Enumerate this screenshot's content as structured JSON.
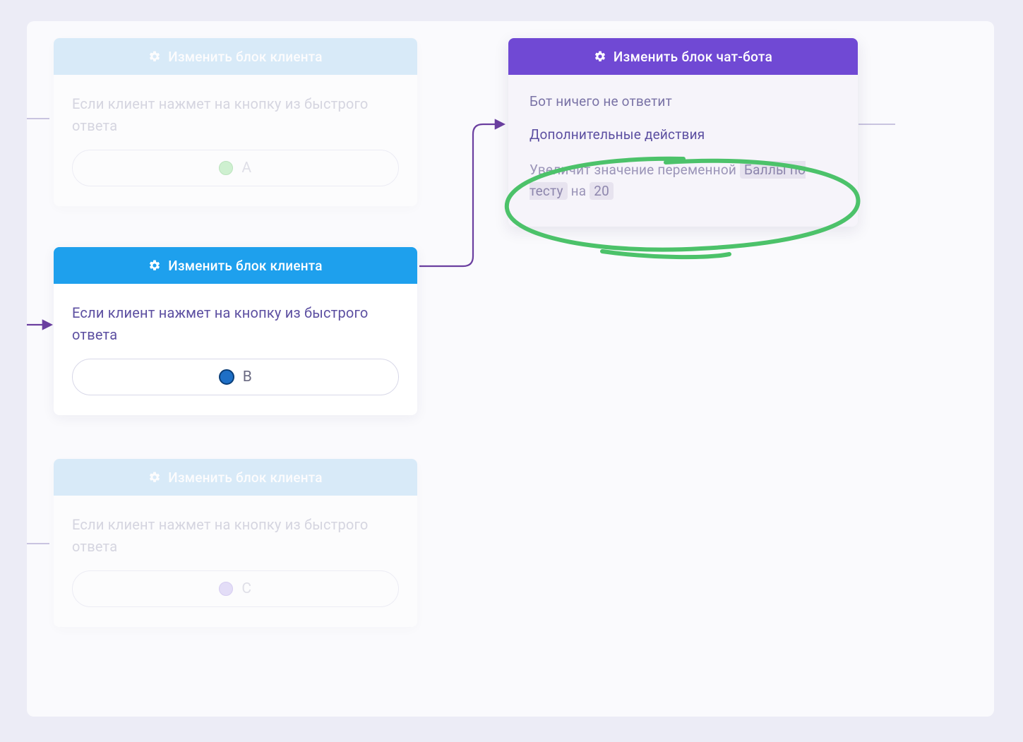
{
  "clientBlocks": {
    "headerLabel": "Изменить блок клиента",
    "bodyText": "Если клиент нажмет на кнопку из быстрого ответа",
    "A": {
      "optionLabel": "A"
    },
    "B": {
      "optionLabel": "B"
    },
    "C": {
      "optionLabel": "C"
    }
  },
  "botBlock": {
    "headerLabel": "Изменить блок чат-бота",
    "noReplyText": "Бот ничего не ответит",
    "extraActionsLabel": "Дополнительные действия",
    "action": {
      "prefix": "Увеличит значение переменной",
      "variableName": "Баллы по тесту",
      "middle": "на",
      "value": "20"
    }
  }
}
